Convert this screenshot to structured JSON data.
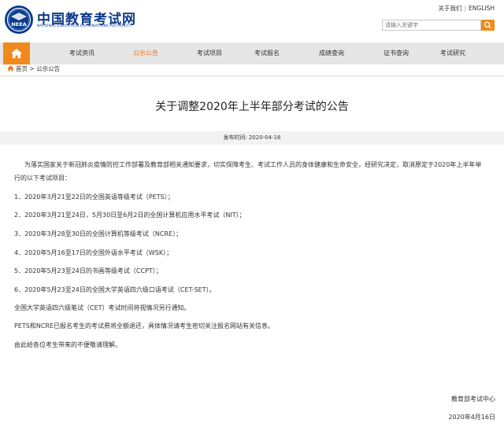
{
  "site": {
    "name_cn": "中国教育考试网",
    "name_en": "NATIONAL EDUCATION EXAMINATIONS AUTHORITY",
    "emblem_text": "NEEA"
  },
  "toplinks": {
    "about": "关于我们",
    "english": "ENGLISH"
  },
  "search": {
    "placeholder": "请输入关键字",
    "button_icon": "search-icon"
  },
  "nav": {
    "home_icon": "home-icon",
    "items": [
      {
        "label": "考试资讯"
      },
      {
        "label": "公示公告"
      },
      {
        "label": "考试项目"
      },
      {
        "label": "考试报名"
      },
      {
        "label": "成绩查询"
      },
      {
        "label": "证书查询"
      },
      {
        "label": "考试研究"
      }
    ],
    "active": "公示公告"
  },
  "breadcrumb": {
    "home": "首页",
    "separator": ">",
    "current": "公示公告"
  },
  "article": {
    "title": "关于调整2020年上半年部分考试的公告",
    "date_label": "发布时间:",
    "date_value": "2020-04-16",
    "intro_line1": "为落实国家关于新冠肺炎疫情防控工作部署及教育部相关通知要求，切实保障考生、考试工作人员的身体健康和生命安全，经研究决定，取消原定于2020年上半年举",
    "intro_line2": "行的以下考试项目：",
    "items": [
      "1．2020年3月21至22日的全国英语等级考试（PETS）；",
      "2．2020年3月21至24日，5月30日至6月2日的全国计算机应用水平考试（NIT）；",
      "3．2020年3月28至30日的全国计算机等级考试（NCRE）；",
      "4．2020年5月16至17日的全国外语水平考试（WSK）；",
      "5．2020年5月23至24日的书画等级考试（CCPT）；",
      "6．2020年5月23至24日的全国大学英语四六级口语考试（CET-SET）。"
    ],
    "note_cet": "全国大学英语四六级笔试（CET）考试时间将视情况另行通知。",
    "note_refund": "PETS和NCRE已报名考生的考试费将全额退还，具体情况请考生密切关注报名网站有关信息。",
    "note_apology": "由此给各位考生带来的不便敬请理解。",
    "signature_org": "教育部考试中心",
    "signature_date": "2020年4月16日"
  },
  "colors": {
    "brand_blue": "#0b3b8c",
    "accent_orange": "#f08a1c",
    "nav_bg": "#e6e6e6"
  }
}
